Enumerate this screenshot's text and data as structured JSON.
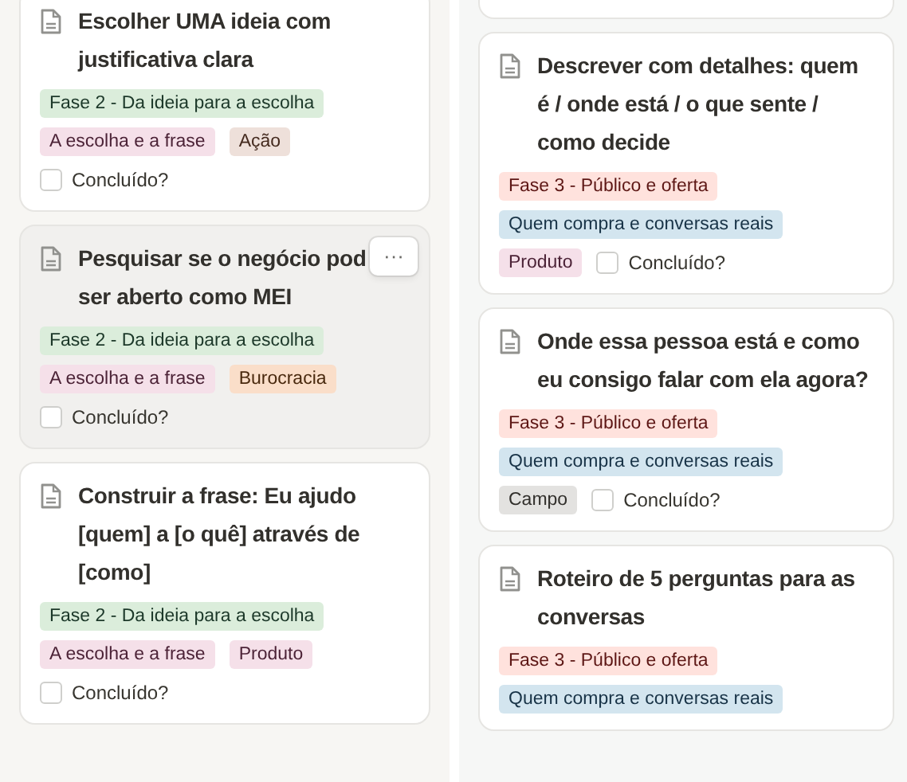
{
  "columns": [
    {
      "cards": [
        {
          "title": "Escolher UMA ideia com justificativa clara",
          "hovered": false,
          "rows": [
            [
              {
                "kind": "tag",
                "label": "Fase 2 - Da ideia para a escolha",
                "color": "#dbeddb"
              }
            ],
            [
              {
                "kind": "tag",
                "label": "A escolha e a frase",
                "color": "#f5e0e9"
              },
              {
                "kind": "tag",
                "label": "Ação",
                "color": "#eee0da"
              }
            ],
            [
              {
                "kind": "checkbox",
                "label": "Concluído?",
                "checked": false
              }
            ]
          ]
        },
        {
          "title_lines": [
            "Pesquisar se o negócio pod",
            "ser aberto como MEI"
          ],
          "hovered": true,
          "menu_button": "···",
          "rows": [
            [
              {
                "kind": "tag",
                "label": "Fase 2 - Da ideia para a escolha",
                "color": "#dbeddb"
              }
            ],
            [
              {
                "kind": "tag",
                "label": "A escolha e a frase",
                "color": "#f5e0e9"
              },
              {
                "kind": "tag",
                "label": "Burocracia",
                "color": "#fadec9"
              }
            ],
            [
              {
                "kind": "checkbox",
                "label": "Concluído?",
                "checked": false
              }
            ]
          ]
        },
        {
          "title": "Construir a frase: Eu ajudo [quem] a [o quê] através de [como]",
          "hovered": false,
          "rows": [
            [
              {
                "kind": "tag",
                "label": "Fase 2 - Da ideia para a escolha",
                "color": "#dbeddb"
              }
            ],
            [
              {
                "kind": "tag",
                "label": "A escolha e a frase",
                "color": "#f5e0e9"
              },
              {
                "kind": "tag",
                "label": "Produto",
                "color": "#f5e0e9"
              }
            ],
            [
              {
                "kind": "checkbox",
                "label": "Concluído?",
                "checked": false
              }
            ]
          ]
        }
      ]
    },
    {
      "cards": [
        {
          "title": "Descrever com detalhes: quem é / onde está / o que sente / como decide",
          "hovered": false,
          "rows": [
            [
              {
                "kind": "tag",
                "label": "Fase 3 - Público e oferta",
                "color": "#ffe2dd"
              }
            ],
            [
              {
                "kind": "tag",
                "label": "Quem compra e conversas reais",
                "color": "#d3e5ef"
              }
            ],
            [
              {
                "kind": "tag",
                "label": "Produto",
                "color": "#f5e0e9"
              },
              {
                "kind": "checkbox",
                "label": "Concluído?",
                "checked": false
              }
            ]
          ]
        },
        {
          "title": "Onde essa pessoa está e como eu consigo falar com ela agora?",
          "hovered": false,
          "rows": [
            [
              {
                "kind": "tag",
                "label": "Fase 3 - Público e oferta",
                "color": "#ffe2dd"
              }
            ],
            [
              {
                "kind": "tag",
                "label": "Quem compra e conversas reais",
                "color": "#d3e5ef"
              }
            ],
            [
              {
                "kind": "tag",
                "label": "Campo",
                "color": "#e3e2e0"
              },
              {
                "kind": "checkbox",
                "label": "Concluído?",
                "checked": false
              }
            ]
          ]
        },
        {
          "title": "Roteiro de 5 perguntas para as conversas",
          "hovered": false,
          "rows": [
            [
              {
                "kind": "tag",
                "label": "Fase 3 - Público e oferta",
                "color": "#ffe2dd"
              }
            ],
            [
              {
                "kind": "tag",
                "label": "Quem compra e conversas reais",
                "color": "#d3e5ef"
              }
            ]
          ]
        }
      ]
    }
  ]
}
